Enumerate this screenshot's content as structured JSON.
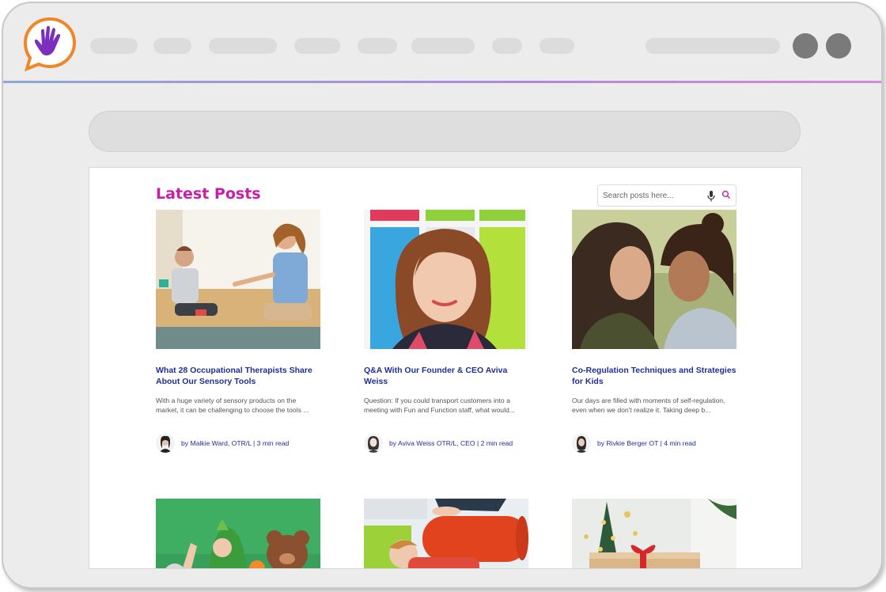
{
  "brand": {
    "logo_icon": "hand-speech-bubble-icon",
    "logo_color": "#7b2fbf",
    "logo_ring_color": "#f0862a"
  },
  "page": {
    "heading": "Latest Posts",
    "heading_color": "#c81eaa",
    "search": {
      "placeholder": "Search posts here...",
      "mic_icon": "microphone-icon",
      "search_icon": "search-icon"
    }
  },
  "posts": [
    {
      "title": "What 28 Occupational Therapists Share About Our Sensory Tools",
      "excerpt": "With a huge variety of sensory products on the market, it can be challenging to choose the tools ...",
      "byline": "by Malkie Ward, OTR/L | 3 min read"
    },
    {
      "title": "Q&A With Our Founder & CEO Aviva Weiss",
      "excerpt": "Question: If you could transport customers into a meeting with Fun and Function staff, what would...",
      "byline": "by Aviva Weiss OTR/L, CEO | 2 min read"
    },
    {
      "title": "Co-Regulation Techniques and Strategies for Kids",
      "excerpt": "Our days are filled with moments of self-regulation, even when we don't realize it. Taking deep b...",
      "byline": "by Rivkie Berger OT | 4 min read"
    }
  ],
  "colors": {
    "title": "#1f2f9a",
    "accent_gradient_start": "#8fa6d6",
    "accent_gradient_end": "#d48ad6"
  }
}
